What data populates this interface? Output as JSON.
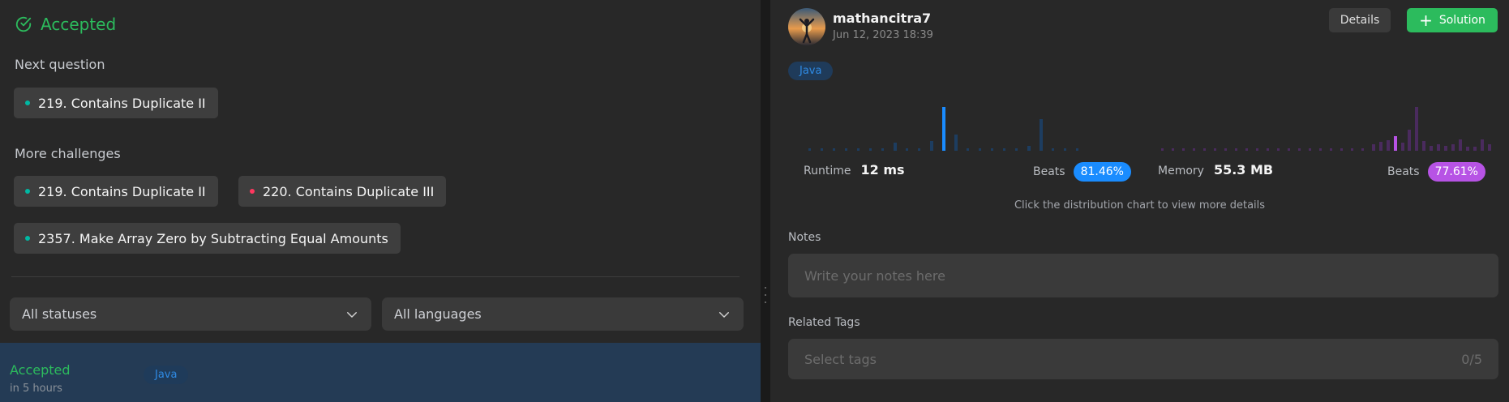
{
  "left": {
    "status_heading": "Accepted",
    "next_question_label": "Next question",
    "next_question": {
      "title": "219. Contains Duplicate II",
      "difficulty": "easy"
    },
    "more_challenges_label": "More challenges",
    "more_challenges": [
      {
        "title": "219. Contains Duplicate II",
        "difficulty": "easy"
      },
      {
        "title": "220. Contains Duplicate III",
        "difficulty": "hard"
      },
      {
        "title": "2357. Make Array Zero by Subtracting Equal Amounts",
        "difficulty": "easy"
      }
    ],
    "filters": {
      "status": "All statuses",
      "language": "All languages"
    },
    "submission": {
      "status": "Accepted",
      "time": "in 5 hours",
      "language": "Java"
    }
  },
  "right": {
    "user": {
      "name": "mathancitra7",
      "date": "Jun 12, 2023 18:39"
    },
    "buttons": {
      "details": "Details",
      "solution": "Solution"
    },
    "language": "Java",
    "runtime": {
      "label": "Runtime",
      "value": "12 ms",
      "beats_label": "Beats",
      "beats": "81.46%"
    },
    "memory": {
      "label": "Memory",
      "value": "55.3 MB",
      "beats_label": "Beats",
      "beats": "77.61%"
    },
    "hint": "Click the distribution chart to view more details",
    "notes": {
      "label": "Notes",
      "placeholder": "Write your notes here"
    },
    "tags": {
      "label": "Related Tags",
      "placeholder": "Select tags",
      "count": "0/5"
    }
  },
  "colors": {
    "accepted": "#2cbb5d",
    "easy": "#00b8a3",
    "hard": "#ff375f",
    "runtime_accent": "#1a8cff",
    "memory_accent": "#b753e5"
  },
  "icons": {
    "status": "check-circle-icon",
    "select": "chevron-down-icon",
    "solution": "plus-icon"
  }
}
